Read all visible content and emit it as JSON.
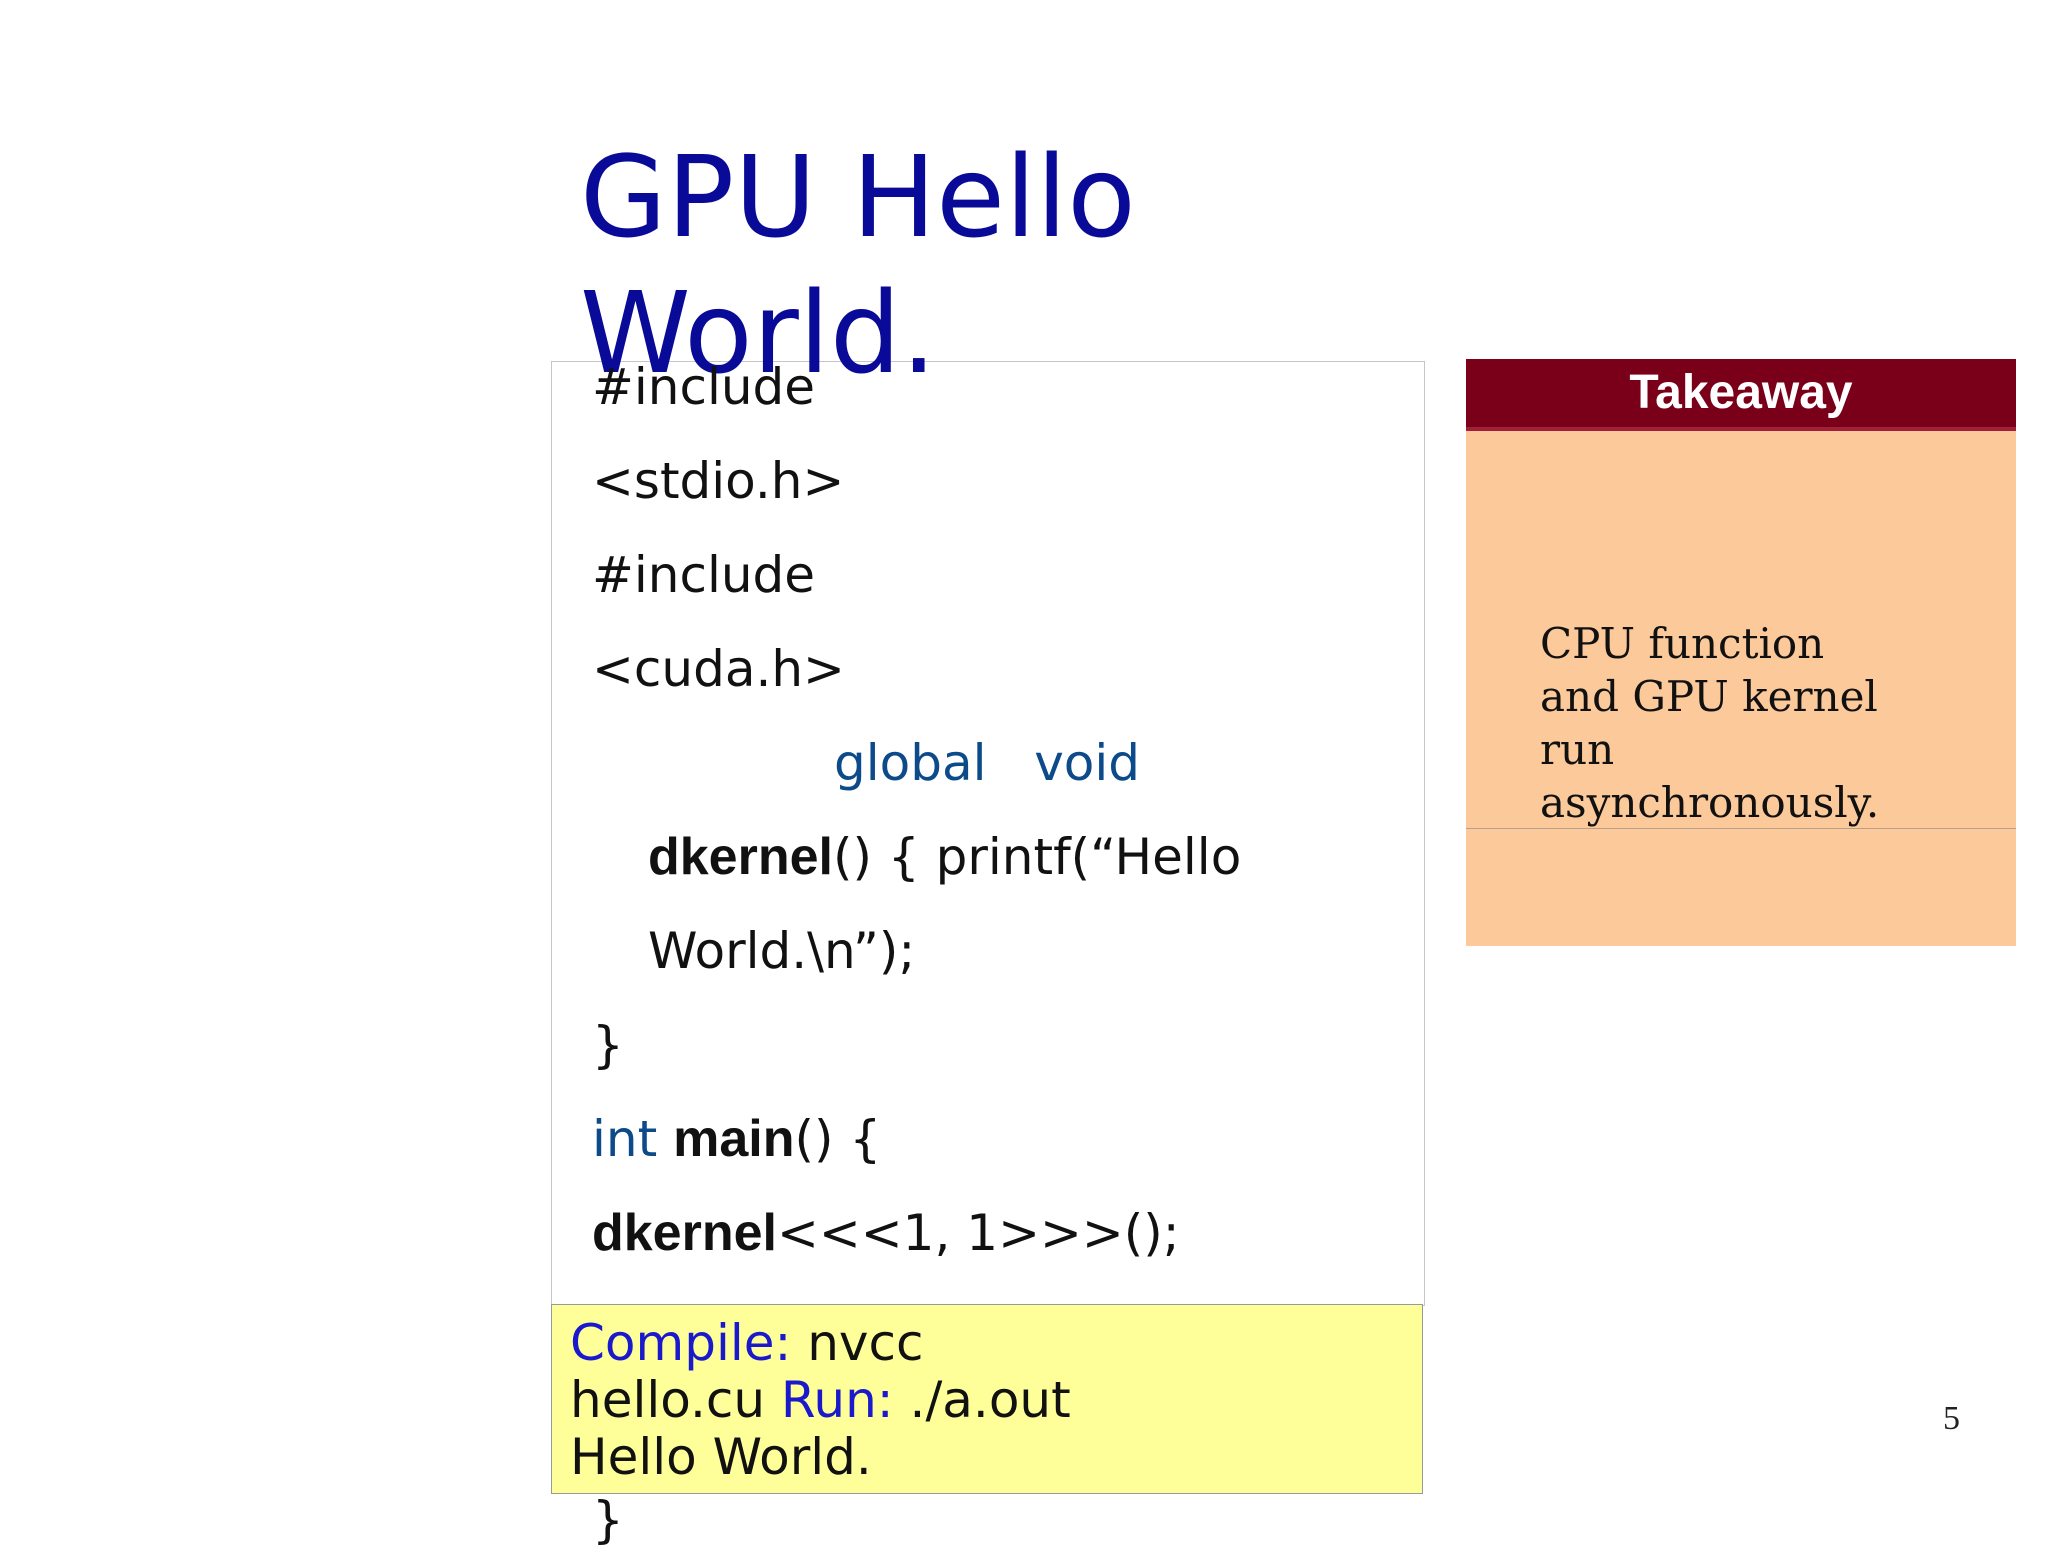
{
  "slide": {
    "title": "GPU Hello World.",
    "page_number": "5"
  },
  "code": {
    "line1": "#include",
    "line2": "<stdio.h>",
    "line3": "#include",
    "line4": "<cuda.h>",
    "global_kw": "global",
    "void_kw": "void",
    "kernel_name": "dkernel",
    "kernel_rest": "() { printf(“Hello",
    "kernel_cont": "World.\\n”);",
    "close_brace": "}",
    "int_kw": "int",
    "main_name": "main",
    "main_rest": "() {",
    "launch_name": "dkernel",
    "launch_rest": "<<<1, 1>>>();",
    "final_brace": "}"
  },
  "compile": {
    "compile_label": "Compile:",
    "compile_cmd_1": " nvcc",
    "compile_cmd_2": "hello.cu ",
    "run_label": "Run:",
    "run_cmd": " ./a.out",
    "output": "Hello World."
  },
  "takeaway": {
    "header": "Takeaway",
    "text": "CPU function and GPU kernel run asynchronously."
  }
}
